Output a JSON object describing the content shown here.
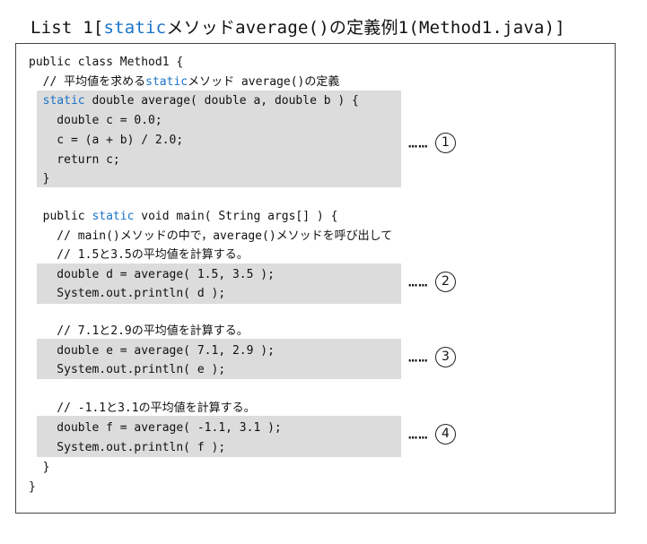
{
  "title": {
    "prefix": "List 1[",
    "keyword": "static",
    "suffix": "メソッドaverage()の定義例1(Method1.java)]"
  },
  "code": {
    "class_decl": "public class Method1 {",
    "comment_avg": {
      "pre": "  // 平均値を求める",
      "kw": "static",
      "post": "メソッド average()の定義"
    },
    "method_decl": {
      "kw": "  static",
      "post": " double average( double a, double b ) {"
    },
    "avg_l1": "    double c = 0.0;",
    "avg_l2": "    c = (a + b) / 2.0;",
    "avg_l3": "    return c;",
    "avg_close": "  }",
    "main_decl": {
      "pre": "  public ",
      "kw": "static",
      "post": " void main( String args[] ) {"
    },
    "c1": "    // main()メソッドの中で，average()メソッドを呼び出して",
    "c2": "    // 1.5と3.5の平均値を計算する。",
    "d1": "    double d = average( 1.5, 3.5 );",
    "d2": "    System.out.println( d );",
    "c3": "    // 7.1と2.9の平均値を計算する。",
    "e1": "    double e = average( 7.1, 2.9 );",
    "e2": "    System.out.println( e );",
    "c4": "    // -1.1と3.1の平均値を計算する。",
    "f1": "    double f = average( -1.1, 3.1 );",
    "f2": "    System.out.println( f );",
    "main_close": "  }",
    "class_close": "}"
  },
  "annotations": [
    {
      "dots": "……",
      "num": "1"
    },
    {
      "dots": "……",
      "num": "2"
    },
    {
      "dots": "……",
      "num": "3"
    },
    {
      "dots": "……",
      "num": "4"
    }
  ]
}
